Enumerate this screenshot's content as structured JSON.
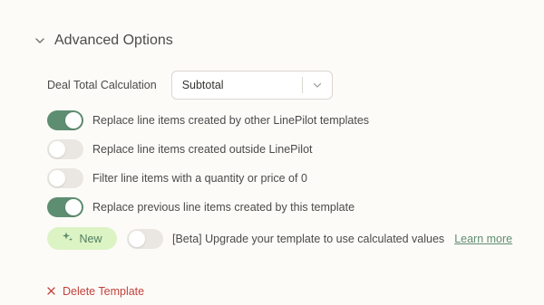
{
  "advanced_options": {
    "title": "Advanced Options",
    "deal_total": {
      "label": "Deal Total Calculation",
      "selected": "Subtotal"
    },
    "toggles": [
      {
        "label": "Replace line items created by other LinePilot templates",
        "on": true
      },
      {
        "label": "Replace line items created outside LinePilot",
        "on": false
      },
      {
        "label": "Filter line items with a quantity or price of 0",
        "on": false
      },
      {
        "label": "Replace previous line items created by this template",
        "on": true
      }
    ],
    "beta": {
      "badge": "New",
      "label": "[Beta] Upgrade your template to use calculated values",
      "on": false,
      "link": "Learn more"
    },
    "delete": {
      "label": "Delete Template"
    }
  },
  "colors": {
    "toggle_on": "#5e8e72",
    "toggle_off": "#eae7e2",
    "badge_bg": "#dcf3c4",
    "danger": "#c2423b",
    "link": "#5f8d6f"
  }
}
